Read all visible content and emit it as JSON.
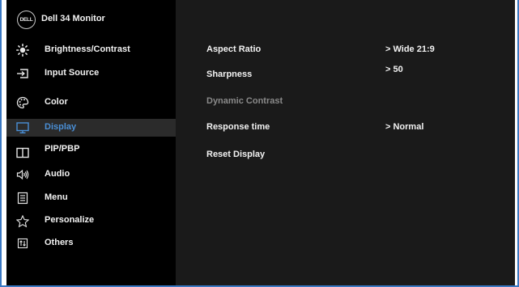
{
  "header": {
    "logo_text": "DELL",
    "model": "Dell 34 Monitor"
  },
  "menu": {
    "items": [
      {
        "label": "Brightness/Contrast",
        "icon": "brightness-icon"
      },
      {
        "label": "Input Source",
        "icon": "input-source-icon"
      },
      {
        "label": "Color",
        "icon": "color-palette-icon"
      },
      {
        "label": "Display",
        "icon": "display-icon",
        "selected": true
      },
      {
        "label": "PIP/PBP",
        "icon": "pip-pbp-icon"
      },
      {
        "label": "Audio",
        "icon": "audio-icon"
      },
      {
        "label": "Menu",
        "icon": "menu-icon"
      },
      {
        "label": "Personalize",
        "icon": "star-icon"
      },
      {
        "label": "Others",
        "icon": "others-icon"
      }
    ]
  },
  "display_options": [
    {
      "label": "Aspect Ratio",
      "value": "> Wide 21:9",
      "enabled": true
    },
    {
      "label": "Sharpness",
      "value": "> 50",
      "enabled": true
    },
    {
      "label": "Dynamic Contrast",
      "value": "",
      "enabled": false
    },
    {
      "label": "Response time",
      "value": "> Normal",
      "enabled": true
    },
    {
      "label": "Reset Display",
      "value": "",
      "enabled": true
    }
  ],
  "colors": {
    "accent": "#4a8fd6",
    "frame": "#3a78c2",
    "background": "#000000",
    "panel": "#1a1a1a",
    "disabled_text": "#8a8a8a"
  }
}
